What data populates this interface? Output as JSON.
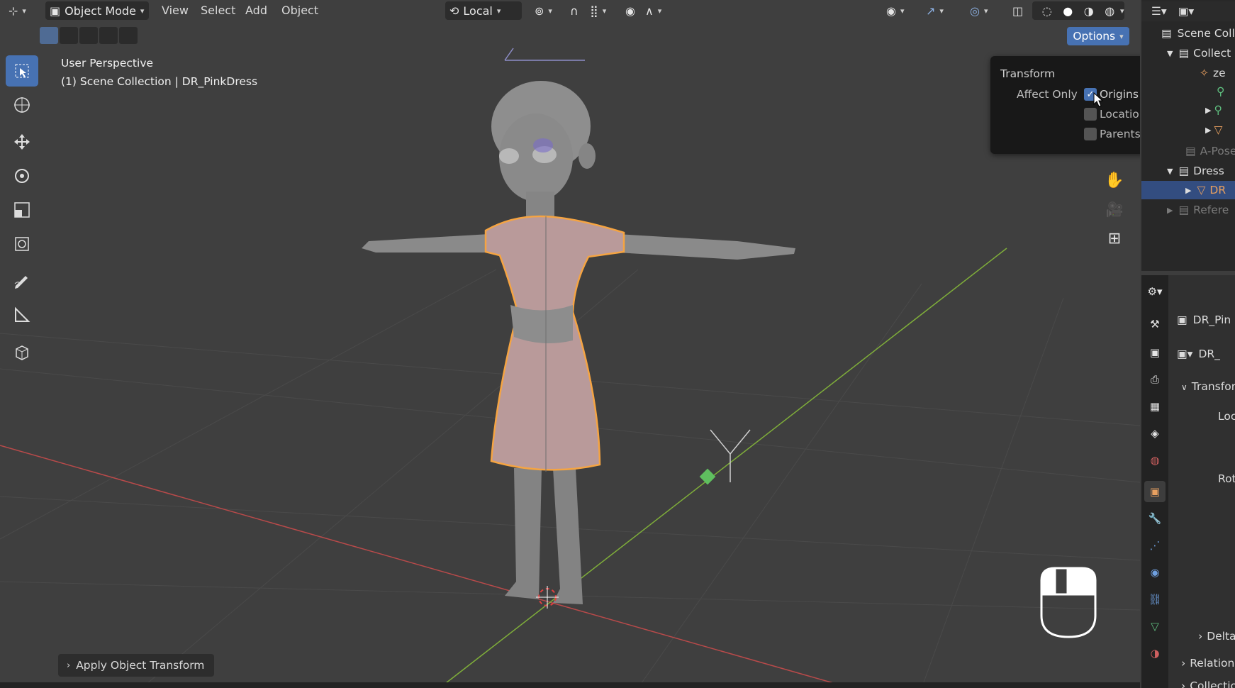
{
  "header": {
    "mode_label": "Object Mode",
    "menus": [
      "View",
      "Select",
      "Add",
      "Object"
    ],
    "transform_orientation": "Local"
  },
  "viewport": {
    "view_name": "User Perspective",
    "collection_info": "(1) Scene Collection | DR_PinkDress",
    "options_label": "Options",
    "last_operator": "Apply Object Transform"
  },
  "options_popup": {
    "title": "Transform",
    "affect_label": "Affect Only",
    "items": [
      {
        "label": "Origins",
        "checked": true
      },
      {
        "label": "Locations",
        "checked": false
      },
      {
        "label": "Parents",
        "checked": false
      }
    ]
  },
  "outliner": {
    "rows": [
      "Scene Coll",
      "Collect",
      "ze",
      "A-Pose",
      "Dress",
      "DR",
      "Refere"
    ]
  },
  "properties": {
    "object_name": "DR_Pin",
    "data_name": "DR_",
    "panels": [
      "Transfor",
      "Loc",
      "Rot",
      "Delta",
      "Relation",
      "Collectio"
    ]
  },
  "colors": {
    "accent": "#4772b3",
    "selection_outline": "#f5a442",
    "x_axis": "#b94a4a",
    "y_axis": "#7fae3a"
  }
}
